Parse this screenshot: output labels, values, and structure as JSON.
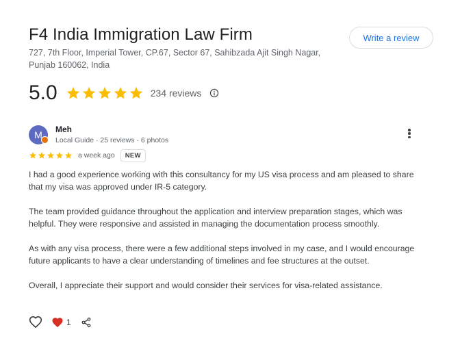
{
  "place": {
    "name": "F4 India Immigration Law Firm",
    "address": "727, 7th Floor, Imperial Tower, CP.67, Sector 67, Sahibzada Ajit Singh Nagar, Punjab 160062, India"
  },
  "write_review_label": "Write a review",
  "rating": {
    "score": "5.0",
    "stars": 5,
    "count_label": "234 reviews",
    "star_color": "#fbbc04"
  },
  "review": {
    "avatar_letter": "M",
    "avatar_color": "#5c6bc0",
    "author": "Meh",
    "author_meta": "Local Guide · 25 reviews · 6 photos",
    "stars": 5,
    "time": "a week ago",
    "badge": "NEW",
    "paragraphs": [
      "I had a good experience working with this consultancy for my US visa process and am pleased to share that my visa was approved under IR-5 category.",
      "The team provided guidance throughout the application and interview preparation stages, which was helpful. They were responsive and assisted in managing the documentation process smoothly.",
      "As with any visa process, there were a few additional steps involved in my case, and I would encourage future applicants to have a clear understanding of timelines and fee structures at the outset.",
      "Overall, I appreciate their support and would consider their services for visa-related assistance."
    ],
    "like_count": "1",
    "heart_color": "#d93025"
  },
  "icons": {
    "info": "info-icon",
    "more": "more-vert-icon",
    "like": "heart-outline-icon",
    "reaction": "heart-filled-icon",
    "share": "share-icon"
  }
}
